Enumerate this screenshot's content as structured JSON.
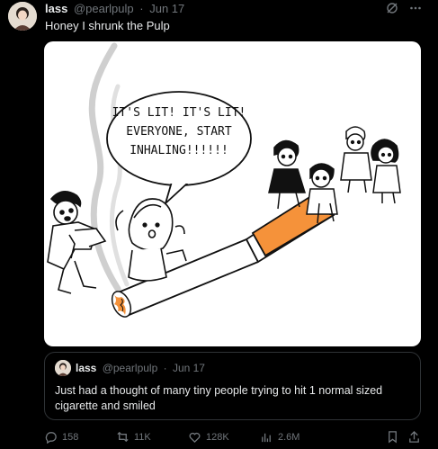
{
  "tweet": {
    "display_name": "lass",
    "handle": "@pearlpulp",
    "separator": "·",
    "date": "Jun 17",
    "text": "Honey I shrunk the Pulp"
  },
  "comic": {
    "speech": [
      "IT'S LIT! IT'S LIT!",
      "EVERYONE, START",
      "INHALING!!!!!!"
    ]
  },
  "quoted": {
    "display_name": "lass",
    "handle": "@pearlpulp",
    "separator": "·",
    "date": "Jun 17",
    "text": "Just had a thought of many tiny people trying to hit 1 normal sized cigarette and smiled"
  },
  "actions": {
    "replies": "158",
    "reposts": "11K",
    "likes": "128K",
    "views": "2.6M"
  },
  "icons": [
    "grok-icon",
    "more-icon",
    "reply-icon",
    "repost-icon",
    "like-icon",
    "views-icon",
    "bookmark-icon",
    "share-icon"
  ],
  "colors": {
    "background": "#000000",
    "secondary_text": "#71767b",
    "filter_orange": "#f5923a"
  }
}
